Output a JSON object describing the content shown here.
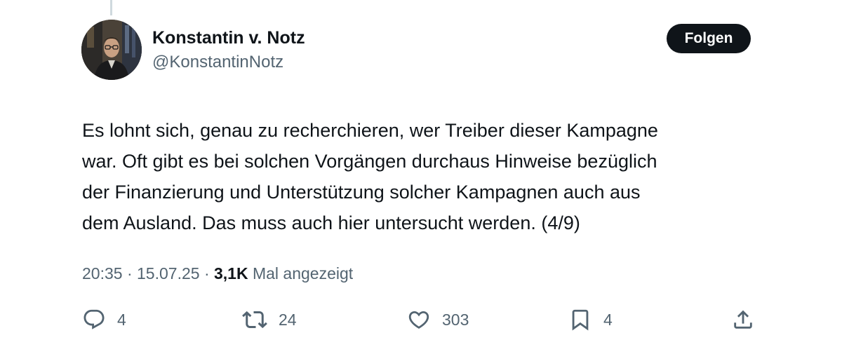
{
  "author": {
    "name": "Konstantin v. Notz",
    "handle": "@KonstantinNotz"
  },
  "follow_button": {
    "label": "Folgen"
  },
  "tweet": {
    "text_lines": [
      "Es lohnt sich, genau zu recherchieren, wer Treiber dieser Kampagne",
      "war. Oft gibt es bei solchen Vorgängen durchaus Hinweise bezüglich",
      "der Finanzierung und Unterstützung solcher Kampagnen auch aus",
      "dem Ausland. Das muss auch hier untersucht werden. (4/9)"
    ]
  },
  "meta": {
    "time": "20:35",
    "separator": "·",
    "date": "15.07.25",
    "views_count": "3,1K",
    "views_label": "Mal angezeigt"
  },
  "actions": {
    "replies": "4",
    "reposts": "24",
    "likes": "303",
    "bookmarks": "4"
  },
  "icons": {
    "reply": "reply-icon",
    "repost": "repost-icon",
    "like": "heart-icon",
    "bookmark": "bookmark-icon",
    "share": "share-icon"
  },
  "colors": {
    "text_primary": "#0f1419",
    "text_secondary": "#536471",
    "button_bg": "#0f1419",
    "button_text": "#ffffff",
    "thread_line": "#cfd9de"
  }
}
